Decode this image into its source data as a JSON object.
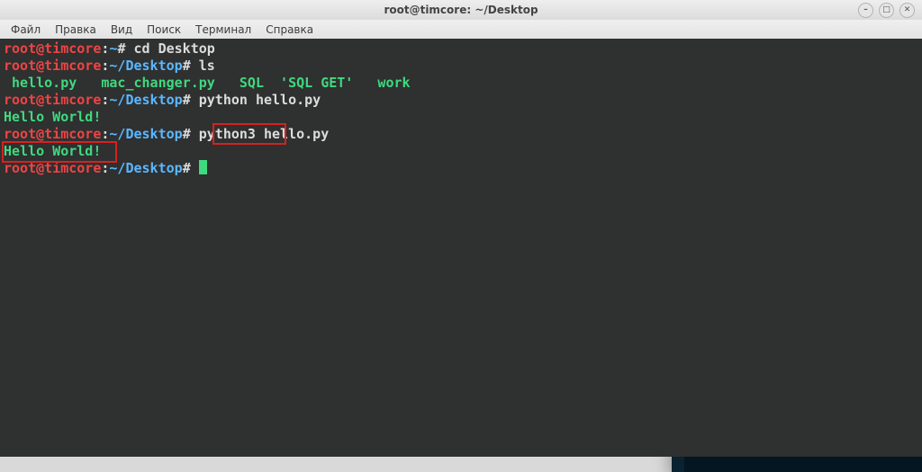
{
  "titlebar": {
    "title": "root@timcore: ~/Desktop"
  },
  "window_controls": {
    "minimize": "–",
    "maximize": "□",
    "close": "✕"
  },
  "menubar": {
    "items": [
      "Файл",
      "Правка",
      "Вид",
      "Поиск",
      "Терминал",
      "Справка"
    ]
  },
  "terminal": {
    "user": "root@timcore",
    "home_path": "~",
    "desktop_path": "~/Desktop",
    "hash": "#",
    "lines": {
      "cd_cmd": "cd Desktop",
      "ls_cmd": "ls",
      "files_row": " hello.py   mac_changer.py   SQL  'SQL GET'   work",
      "py_cmd": "python hello.py",
      "out1": "Hello World!",
      "py3_cmd_a": "python3",
      "py3_cmd_b": " hello.py",
      "out2": "Hello World!",
      "cursor": ""
    }
  }
}
